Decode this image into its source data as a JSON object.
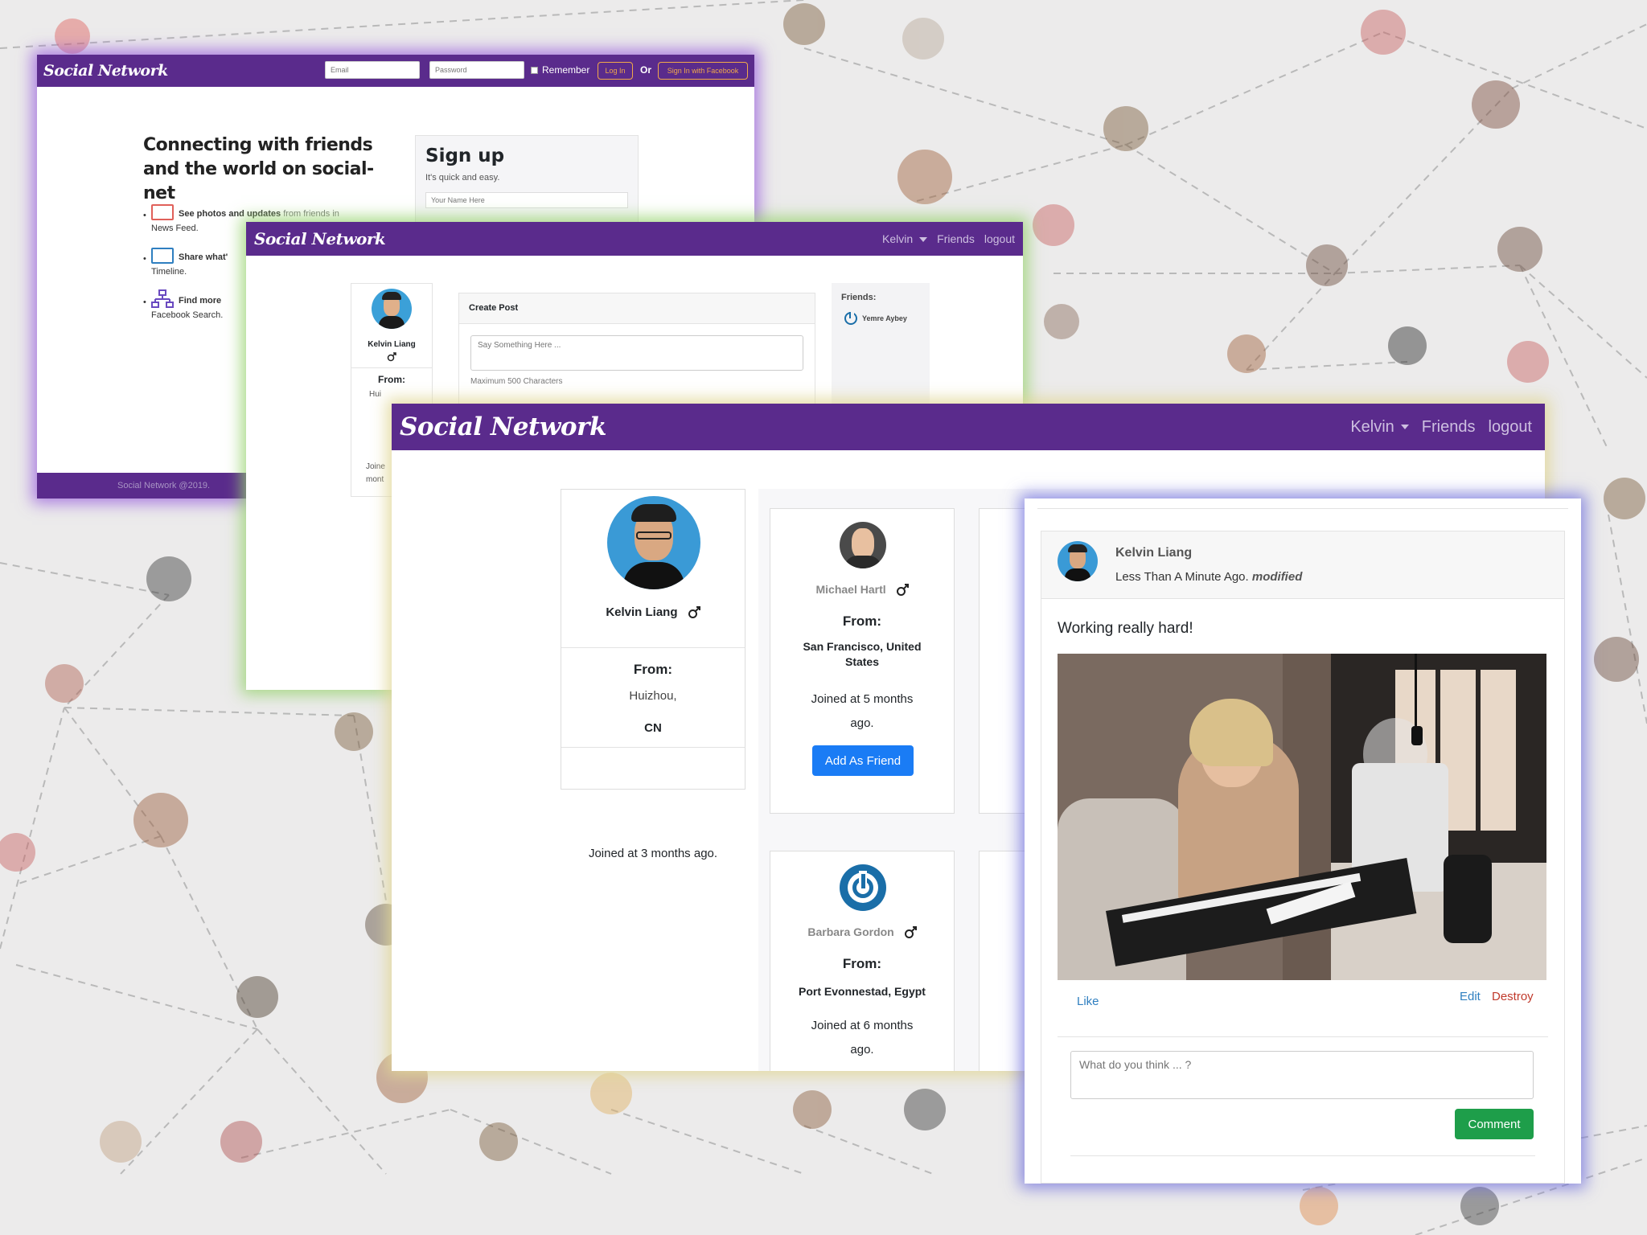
{
  "landing": {
    "brand": "Social Network",
    "email_placeholder": "Email",
    "password_placeholder": "Password",
    "remember_label": "Remember",
    "login_button": "Log In",
    "or_label": "Or",
    "facebook_button": "Sign In with Facebook",
    "headline": "Connecting with friends and the world on social-net",
    "features": [
      {
        "bold": "See photos and updates",
        "rest": " from friends in",
        "sub": "News Feed."
      },
      {
        "bold": "Share what'",
        "rest": "",
        "sub": "Timeline."
      },
      {
        "bold": "Find more",
        "rest": "",
        "sub": "Facebook Search."
      }
    ],
    "signup_title": "Sign up",
    "signup_subtitle": "It's quick and easy.",
    "name_placeholder": "Your Name Here",
    "footer": "Social Network @2019."
  },
  "home": {
    "brand": "Social Network",
    "nav_user": "Kelvin",
    "nav_friends": "Friends",
    "nav_logout": "logout",
    "profile_name": "Kelvin Liang",
    "profile_from_label": "From:",
    "profile_from_fragment": "Hui",
    "profile_joined_fragment_1": "Joine",
    "profile_joined_fragment_2": "mont",
    "create_post_title": "Create Post",
    "post_placeholder": "Say Something Here ...",
    "max_chars": "Maximum 500 Characters",
    "friends_label": "Friends:",
    "friend_name": "Yemre Aybey"
  },
  "friends_page": {
    "brand": "Social Network",
    "nav_user": "Kelvin",
    "nav_friends": "Friends",
    "nav_logout": "logout",
    "me": {
      "name": "Kelvin Liang",
      "from_label": "From:",
      "city": "Huizhou,",
      "country": "CN",
      "joined": "Joined at 3 months ago."
    },
    "users": [
      {
        "name": "Michael Hartl",
        "from_label": "From:",
        "location": "San Francisco, United States",
        "joined": "Joined at 5 months ago.",
        "button": "Add As Friend"
      },
      {
        "name": "Barbara Gordon",
        "from_label": "From:",
        "location": "Port Evonnestad, Egypt",
        "joined": "Joined at 6 months ago."
      }
    ]
  },
  "post": {
    "author": "Kelvin Liang",
    "time": "Less Than A Minute Ago.",
    "modified": "modified",
    "body": "Working really hard!",
    "like": "Like",
    "edit": "Edit",
    "destroy": "Destroy",
    "comment_placeholder": "What do you think ... ?",
    "comment_button": "Comment"
  },
  "colors": {
    "brand_purple": "#5a2b8c",
    "primary_blue": "#1a7cf5",
    "success_green": "#1e9e4a",
    "danger_red": "#c0392b",
    "link_blue": "#2f7fc0",
    "facebook_accent": "#f0a84a"
  }
}
